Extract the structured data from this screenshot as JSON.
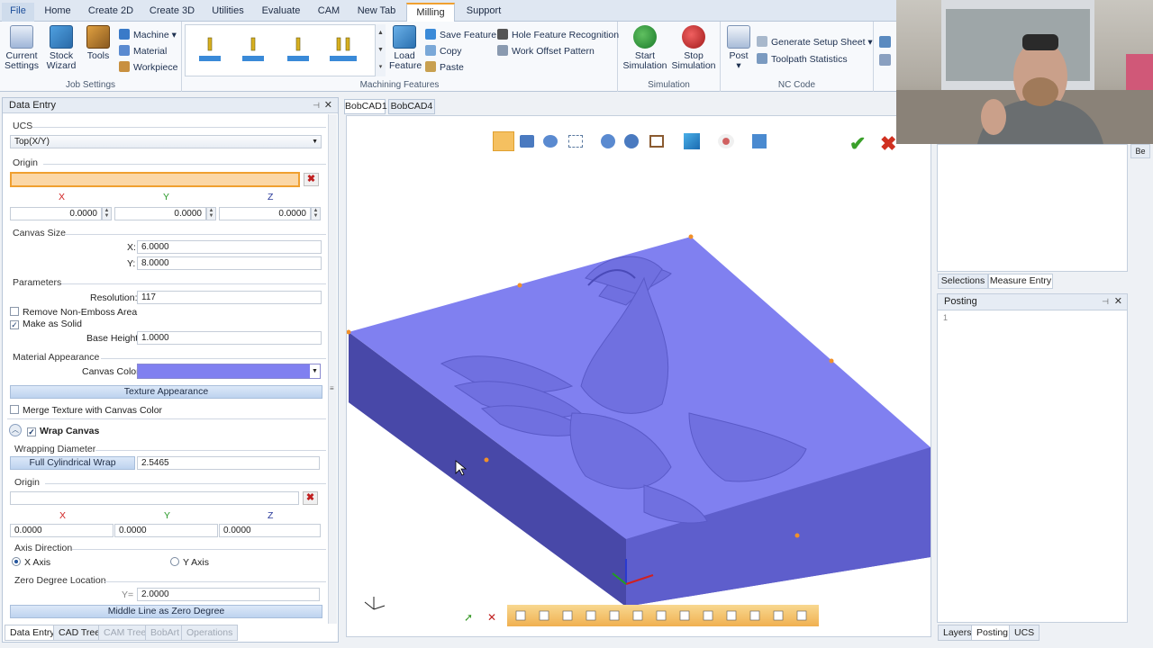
{
  "menu": {
    "tabs": [
      "File",
      "Home",
      "Create 2D",
      "Create 3D",
      "Utilities",
      "Evaluate",
      "CAM",
      "New Tab",
      "Milling",
      "Support"
    ],
    "active": "Milling"
  },
  "ribbon": {
    "job_settings": {
      "label": "Job Settings",
      "current_settings": "Current\nSettings",
      "stock_wizard": "Stock\nWizard",
      "tools": "Tools",
      "machine": "Machine",
      "material": "Material",
      "workpiece": "Workpiece"
    },
    "machining_features": {
      "label": "Machining Features",
      "load_feature": "Load\nFeature",
      "save_feature": "Save Feature",
      "copy": "Copy",
      "paste": "Paste",
      "hole_feature_recognition": "Hole Feature Recognition",
      "work_offset_pattern": "Work Offset Pattern"
    },
    "simulation": {
      "label": "Simulation",
      "start": "Start\nSimulation",
      "stop": "Stop\nSimulation"
    },
    "nc_code": {
      "label": "NC Code",
      "post": "Post",
      "generate_setup_sheet": "Generate Setup Sheet",
      "toolpath_statistics": "Toolpath Statistics"
    }
  },
  "data_entry": {
    "title": "Data Entry",
    "ucs_label": "UCS",
    "ucs_value": "Top(X/Y)",
    "origin_label": "Origin",
    "x": "X",
    "y": "Y",
    "z": "Z",
    "origin_x": "0.0000",
    "origin_y": "0.0000",
    "origin_z": "0.0000",
    "canvas_size_label": "Canvas Size",
    "canvas_x_label": "X:",
    "canvas_x": "6.0000",
    "canvas_y_label": "Y:",
    "canvas_y": "8.0000",
    "parameters_label": "Parameters",
    "resolution_label": "Resolution:",
    "resolution": "117",
    "remove_non_emboss": "Remove Non-Emboss Area",
    "make_as_solid": "Make as Solid",
    "base_height_label": "Base Height",
    "base_height": "1.0000",
    "material_appearance_label": "Material Appearance",
    "canvas_color_label": "Canvas Color",
    "canvas_color": "#8080f0",
    "texture_appearance": "Texture Appearance",
    "merge_texture": "Merge Texture with Canvas Color",
    "wrap_canvas": "Wrap Canvas",
    "wrapping_diameter_label": "Wrapping Diameter",
    "full_cylindrical_wrap": "Full Cylindrical Wrap",
    "wrapping_diameter": "2.5465",
    "origin2_label": "Origin",
    "origin2_x": "0.0000",
    "origin2_y": "0.0000",
    "origin2_z": "0.0000",
    "axis_direction_label": "Axis Direction",
    "x_axis": "X Axis",
    "y_axis": "Y Axis",
    "zero_degree_label": "Zero Degree Location",
    "zero_y_label": "Y=",
    "zero_y": "2.0000",
    "middle_line": "Middle Line as Zero Degree"
  },
  "bottom_tabs_left": [
    "Data Entry",
    "CAD Tree",
    "CAM Tree",
    "BobArt",
    "Operations"
  ],
  "doc_tabs": [
    "BobCAD1",
    "BobCAD4"
  ],
  "right_panel": {
    "tabs_top": [
      "Selections",
      "Measure Entry"
    ],
    "posting_title": "Posting",
    "posting_line": "1",
    "tabs_bottom": [
      "Layers",
      "Posting",
      "UCS"
    ]
  },
  "colors": {
    "canvas": "#8080f0",
    "accent_tab": "#f0a030",
    "confirm": "#3aa02a",
    "cancel": "#d03020"
  }
}
